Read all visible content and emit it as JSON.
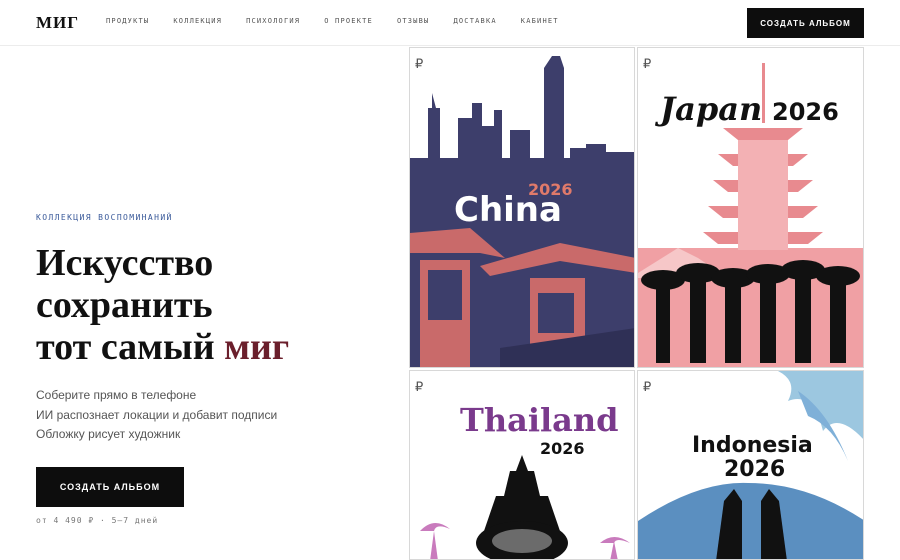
{
  "header": {
    "logo": "МИГ",
    "nav": [
      "ПРОДУКТЫ",
      "КОЛЛЕКЦИЯ",
      "ПСИХОЛОГИЯ",
      "О ПРОЕКТЕ",
      "ОТЗЫВЫ",
      "ДОСТАВКА",
      "КАБИНЕТ"
    ],
    "cta": "СОЗДАТЬ АЛЬБОМ"
  },
  "hero": {
    "eyebrow": "КОЛЛЕКЦИЯ ВОСПОМИНАНИЙ",
    "title_line1": "Искусство",
    "title_line2": "сохранить",
    "title_line3_prefix": "тот самый ",
    "title_line3_accent": "миг",
    "bullets": [
      "Соберите прямо в телефоне",
      "ИИ распознает локации и добавит подписи",
      "Обложку рисует художник"
    ],
    "cta": "СОЗДАТЬ АЛЬБОМ",
    "price": "от 4 490 ₽ · 5–7 дней"
  },
  "covers": [
    {
      "country": "China",
      "year": "2026",
      "bg": "#3d3e6b",
      "accent": "#d86e6e",
      "mark": "₽"
    },
    {
      "country": "Japan",
      "year": "2026",
      "bg": "#f0a0a4",
      "accent": "#e88a8f",
      "mark": "₽"
    },
    {
      "country": "Thailand",
      "year": "2026",
      "bg": "#ffffff",
      "accent": "#8a4aa0",
      "mark": "₽"
    },
    {
      "country": "Indonesia",
      "year": "2026",
      "bg": "#ffffff",
      "accent": "#7fb0d8",
      "mark": "₽"
    }
  ],
  "colors": {
    "accent_word": "#6b1f2c",
    "eyebrow": "#3a5a9a",
    "button_bg": "#0d0d0d"
  }
}
